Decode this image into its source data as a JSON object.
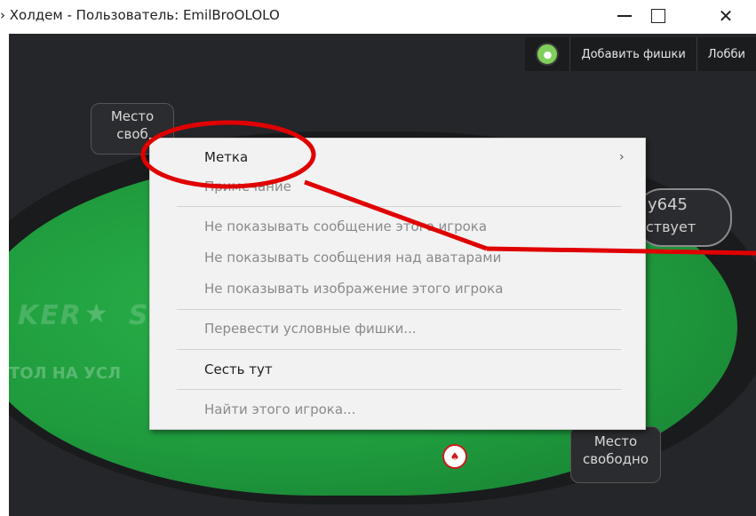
{
  "window": {
    "title": "› Холдем - Пользователь: EmilBroOLOLO",
    "minimize_glyph": "—",
    "close_glyph": "✕"
  },
  "toolbar": {
    "status_icon": "green-status-icon",
    "add_chips": "Добавить фишки",
    "lobby": "Лобби"
  },
  "table": {
    "logo_text": "KER",
    "logo_text2": "S",
    "caption": "ТОЛ НА УСЛ",
    "felt_color": "#1f9a3d"
  },
  "seats": {
    "top_line1": "Место",
    "top_line2": "своб",
    "bottom_line1": "Место",
    "bottom_line2": "свободно"
  },
  "player": {
    "name_fragment": "y645",
    "status_fragment": "ствует"
  },
  "context_menu": {
    "items": [
      {
        "label": "Метка",
        "disabled": false,
        "submenu_arrow": "›"
      },
      {
        "label": "Примечание",
        "disabled": true
      },
      {
        "label": "Не показывать сообщение этого игрока",
        "disabled": true
      },
      {
        "label": "Не показывать сообщения над аватарами",
        "disabled": true
      },
      {
        "label": "Не показывать изображение этого игрока",
        "disabled": true
      },
      {
        "label": "Перевести условные фишки...",
        "disabled": true
      },
      {
        "label": "Сесть тут",
        "disabled": false
      },
      {
        "label": "Найти этого игрока...",
        "disabled": true
      }
    ]
  },
  "annotation": {
    "color": "#e00000"
  }
}
